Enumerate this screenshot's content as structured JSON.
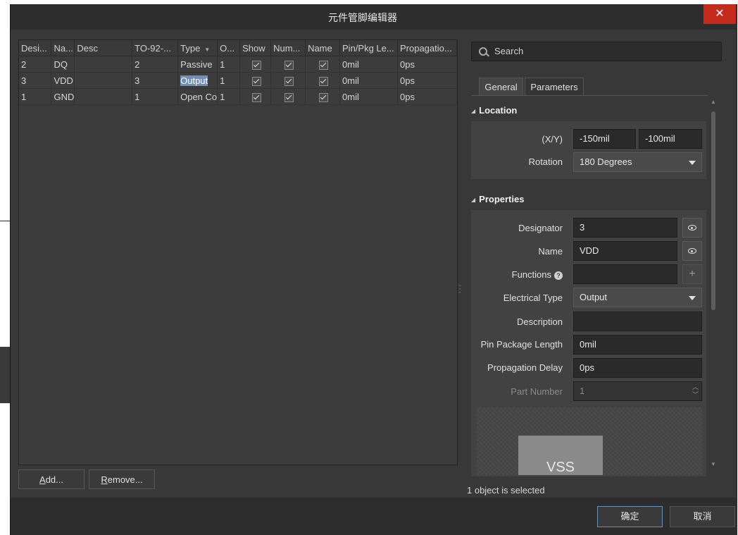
{
  "window": {
    "title": "元件管脚编辑器",
    "close_glyph": "✕"
  },
  "grid": {
    "columns": [
      "Desi...",
      "Na...",
      "Desc",
      "TO-92-...",
      "Type",
      "O...",
      "Show",
      "Num...",
      "Name",
      "Pin/Pkg Le...",
      "Propagatio..."
    ],
    "rows": [
      {
        "designator": "2",
        "name": "DQ",
        "desc": "",
        "to92": "2",
        "type": "Passive",
        "o": "1",
        "show": true,
        "number": true,
        "name_vis": true,
        "pin_pkg": "0mil",
        "prop": "0ps"
      },
      {
        "designator": "3",
        "name": "VDD",
        "desc": "",
        "to92": "3",
        "type": "Output",
        "o": "1",
        "show": true,
        "number": true,
        "name_vis": true,
        "pin_pkg": "0mil",
        "prop": "0ps"
      },
      {
        "designator": "1",
        "name": "GND",
        "desc": "",
        "to92": "1",
        "type": "Open Co",
        "o": "1",
        "show": true,
        "number": true,
        "name_vis": true,
        "pin_pkg": "0mil",
        "prop": "0ps"
      }
    ],
    "selected_row": 1
  },
  "buttons": {
    "add": {
      "accel": "A",
      "rest": "dd..."
    },
    "remove": {
      "accel": "R",
      "rest": "emove..."
    }
  },
  "search": {
    "placeholder": "Search"
  },
  "tabs": [
    {
      "label": "General",
      "active": true
    },
    {
      "label": "Parameters",
      "active": false
    }
  ],
  "location": {
    "title": "Location",
    "xy_label": "(X/Y)",
    "x": "-150mil",
    "y": "-100mil",
    "rotation_label": "Rotation",
    "rotation": "180 Degrees"
  },
  "properties": {
    "title": "Properties",
    "designator_label": "Designator",
    "designator": "3",
    "name_label": "Name",
    "name": "VDD",
    "functions_label": "Functions",
    "functions": "",
    "electrical_type_label": "Electrical Type",
    "electrical_type": "Output",
    "description_label": "Description",
    "description": "",
    "pin_package_length_label": "Pin Package Length",
    "pin_package_length": "0mil",
    "propagation_delay_label": "Propagation Delay",
    "propagation_delay": "0ps",
    "part_number_label": "Part Number",
    "part_number": "1"
  },
  "preview": {
    "pin_label": "VSS"
  },
  "status": {
    "text": "1 object is selected"
  },
  "footer": {
    "ok": "确定",
    "cancel": "取消"
  }
}
